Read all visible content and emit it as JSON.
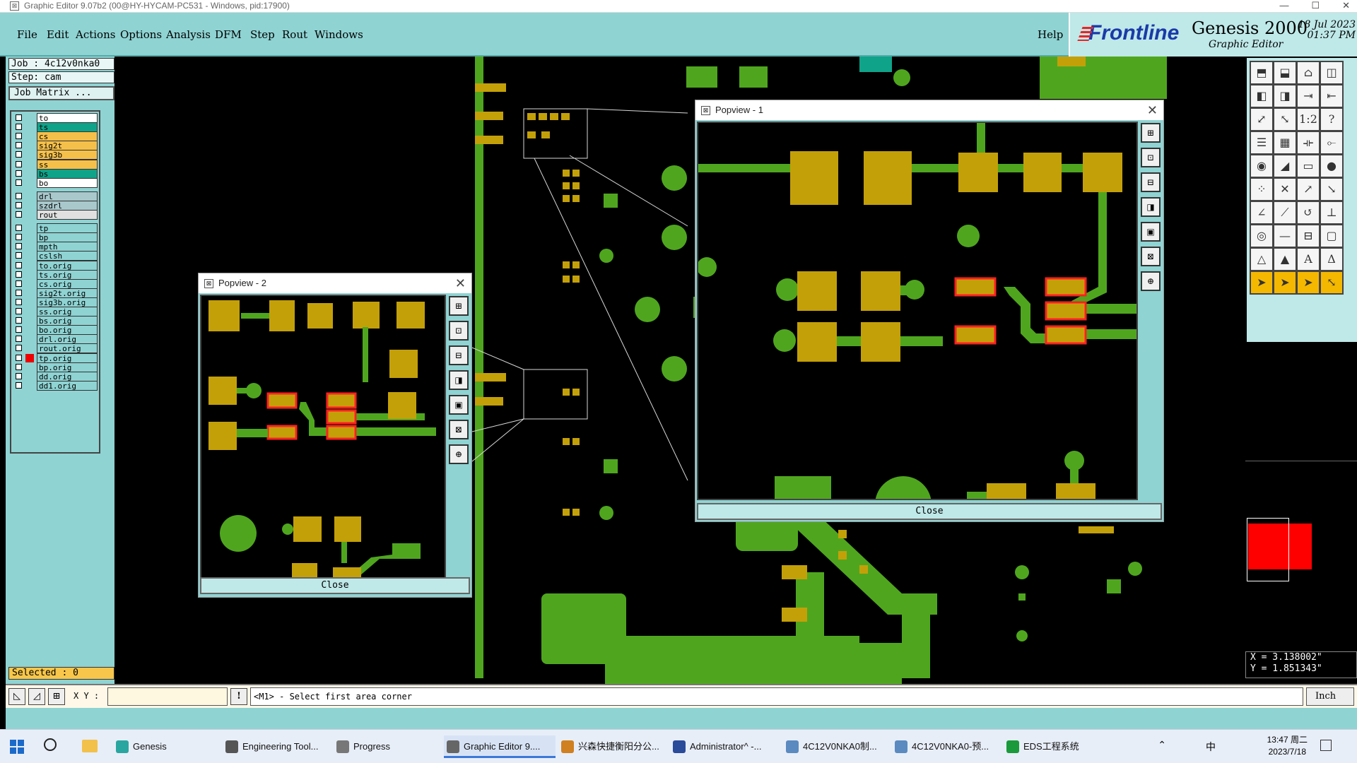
{
  "window": {
    "title": "Graphic Editor 9.07b2 (00@HY-HYCAM-PC531 - Windows, pid:17900)"
  },
  "menu": [
    "File",
    "Edit",
    "Actions",
    "Options",
    "Analysis",
    "DFM",
    "Step",
    "Rout",
    "Windows"
  ],
  "help": "Help",
  "brand": {
    "logo": "Frontline",
    "product": "Genesis 2000",
    "subtitle": "Graphic Editor",
    "date": "18 Jul 2023",
    "time": "01:37 PM"
  },
  "job": {
    "job_label": "Job : 4c12v0nka0",
    "step_label": "Step: cam",
    "matrix_button": "Job Matrix ..."
  },
  "layers": [
    {
      "name": "to",
      "color": "#ffffff",
      "checked": false
    },
    {
      "name": "ts",
      "color": "#0fa38a",
      "checked": false
    },
    {
      "name": "cs",
      "color": "#f5c04a",
      "checked": false
    },
    {
      "name": "sig2t",
      "color": "#f5c04a",
      "checked": false
    },
    {
      "name": "sig3b",
      "color": "#f5c04a",
      "checked": false
    },
    {
      "name": "ss",
      "color": "#f5c04a",
      "checked": false
    },
    {
      "name": "bs",
      "color": "#0fa38a",
      "checked": false
    },
    {
      "name": "bo",
      "color": "#ffffff",
      "checked": false
    },
    {
      "name": "drl",
      "color": "#a8c8cc",
      "checked": false
    },
    {
      "name": "szdrl",
      "color": "#a8c8cc",
      "checked": false
    },
    {
      "name": "rout",
      "color": "#e0e0e0",
      "checked": false
    },
    {
      "name": "tp",
      "color": "#8fd3d3",
      "checked": false
    },
    {
      "name": "bp",
      "color": "#8fd3d3",
      "checked": false
    },
    {
      "name": "mpth",
      "color": "#8fd3d3",
      "checked": false
    },
    {
      "name": "cslsh",
      "color": "#8fd3d3",
      "checked": false
    },
    {
      "name": "to.orig",
      "color": "#8fd3d3",
      "checked": false
    },
    {
      "name": "ts.orig",
      "color": "#8fd3d3",
      "checked": false
    },
    {
      "name": "cs.orig",
      "color": "#8fd3d3",
      "checked": false
    },
    {
      "name": "sig2t.orig",
      "color": "#8fd3d3",
      "checked": false
    },
    {
      "name": "sig3b.orig",
      "color": "#8fd3d3",
      "checked": false
    },
    {
      "name": "ss.orig",
      "color": "#8fd3d3",
      "checked": false
    },
    {
      "name": "bs.orig",
      "color": "#8fd3d3",
      "checked": false
    },
    {
      "name": "bo.orig",
      "color": "#8fd3d3",
      "checked": false
    },
    {
      "name": "drl.orig",
      "color": "#8fd3d3",
      "checked": false
    },
    {
      "name": "rout.orig",
      "color": "#8fd3d3",
      "checked": false
    },
    {
      "name": "tp.orig",
      "color": "#8fd3d3",
      "checked": true
    },
    {
      "name": "bp.orig",
      "color": "#8fd3d3",
      "checked": false
    },
    {
      "name": "dd.orig",
      "color": "#8fd3d3",
      "checked": false
    },
    {
      "name": "dd1.orig",
      "color": "#8fd3d3",
      "checked": false
    }
  ],
  "selected": "Selected : 0",
  "popview1": {
    "title": "Popview - 1",
    "close": "Close"
  },
  "popview2": {
    "title": "Popview - 2",
    "close": "Close"
  },
  "command": {
    "xy_label": "X Y :",
    "xy_value": "",
    "prompt": "<M1> - Select first area corner",
    "unit": "Inch"
  },
  "coords": {
    "x": "X = 3.138002\"",
    "y": "Y = 1.851343\""
  },
  "colors": {
    "copper": "#c4a008",
    "trace": "#4fa61e",
    "highlight": "#ff2020",
    "panel": "#8fd3d3"
  },
  "taskbar": {
    "items": [
      {
        "label": "Genesis",
        "icon": "genesis-icon"
      },
      {
        "label": "Engineering Tool...",
        "icon": "app-icon"
      },
      {
        "label": "Progress",
        "icon": "app-icon"
      },
      {
        "label": "Graphic Editor 9....",
        "icon": "app-icon",
        "active": true
      },
      {
        "label": "兴森快捷衡阳分公...",
        "icon": "browser-icon"
      },
      {
        "label": "Administrator^ -...",
        "icon": "terminal-icon"
      },
      {
        "label": "4C12V0NKA0制...",
        "icon": "doc-icon"
      },
      {
        "label": "4C12V0NKA0-预...",
        "icon": "doc-icon"
      },
      {
        "label": "EDS工程系统",
        "icon": "eds-icon"
      }
    ],
    "time": "13:47 周二",
    "date": "2023/7/18",
    "ime": "中"
  }
}
